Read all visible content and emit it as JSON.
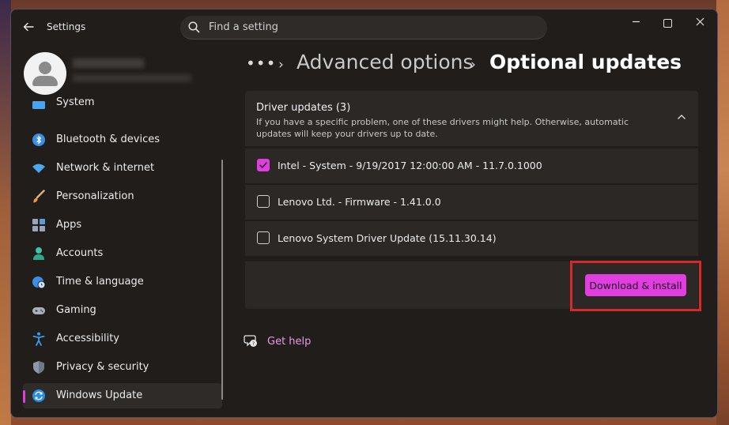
{
  "app": {
    "title": "Settings",
    "search_placeholder": "Find a setting"
  },
  "sidebar": {
    "items": [
      {
        "label": "System",
        "icon": "system-icon"
      },
      {
        "label": "Bluetooth & devices",
        "icon": "bluetooth-icon"
      },
      {
        "label": "Network & internet",
        "icon": "wifi-icon"
      },
      {
        "label": "Personalization",
        "icon": "brush-icon"
      },
      {
        "label": "Apps",
        "icon": "apps-icon"
      },
      {
        "label": "Accounts",
        "icon": "person-icon"
      },
      {
        "label": "Time & language",
        "icon": "globe-clock-icon"
      },
      {
        "label": "Gaming",
        "icon": "gamepad-icon"
      },
      {
        "label": "Accessibility",
        "icon": "accessibility-icon"
      },
      {
        "label": "Privacy & security",
        "icon": "shield-icon"
      },
      {
        "label": "Windows Update",
        "icon": "update-icon",
        "active": true
      }
    ]
  },
  "breadcrumb": {
    "more": "•••",
    "parent": "Advanced options",
    "current": "Optional updates"
  },
  "driver_updates": {
    "title": "Driver updates (3)",
    "description": "If you have a specific problem, one of these drivers might help. Otherwise, automatic updates will keep your drivers up to date.",
    "items": [
      {
        "label": "Intel - System - 9/19/2017 12:00:00 AM - 11.7.0.1000",
        "checked": true
      },
      {
        "label": "Lenovo Ltd. - Firmware - 1.41.0.0",
        "checked": false
      },
      {
        "label": "Lenovo System Driver Update (15.11.30.14)",
        "checked": false
      }
    ],
    "install_button": "Download & install"
  },
  "help": {
    "label": "Get help"
  },
  "colors": {
    "accent": "#e13ee0",
    "highlight": "#d42a2a",
    "background": "#201d1b",
    "card": "#2b2826"
  }
}
